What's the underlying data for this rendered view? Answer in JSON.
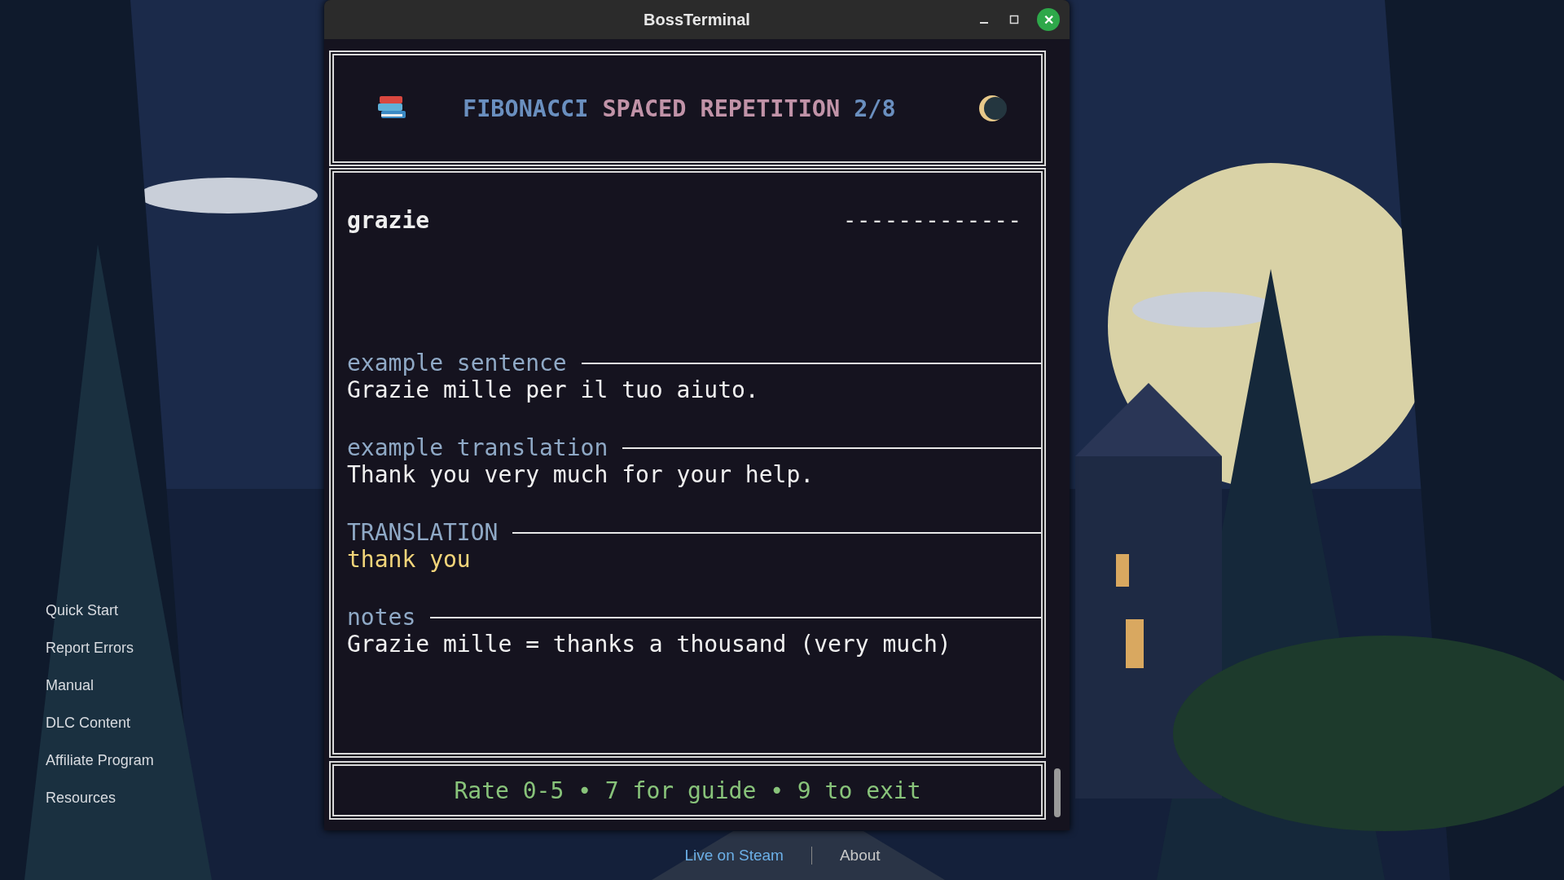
{
  "sidebar": {
    "items": [
      "Quick Start",
      "Report Errors",
      "Manual",
      "DLC Content",
      "Affiliate Program",
      "Resources"
    ]
  },
  "window": {
    "title": "BossTerminal",
    "close_icon": "✕"
  },
  "header": {
    "title_parts": [
      {
        "text": "FIBONACCI",
        "color": "#6a8fbf"
      },
      {
        "text": "SPACED REPETITION",
        "color": "#c193a8"
      },
      {
        "text": "2/8",
        "color": "#6a8fbf"
      }
    ]
  },
  "card": {
    "word": "grazie",
    "hidden_answer": "-------------",
    "sections": [
      {
        "label": "example sentence",
        "value": "Grazie mille per il tuo aiuto.",
        "kind": "plain"
      },
      {
        "label": "example translation",
        "value": "Thank you very much for your help.",
        "kind": "plain"
      },
      {
        "label": "TRANSLATION",
        "value": "thank you",
        "kind": "answer"
      },
      {
        "label": "notes",
        "value": "Grazie mille = thanks a thousand (very much)",
        "kind": "plain"
      }
    ]
  },
  "footer": {
    "hint": "Rate 0-5 • 7 for guide • 9 to exit"
  },
  "links": [
    {
      "label": "Live on Steam",
      "kind": "accent"
    },
    {
      "label": "About",
      "kind": "plain"
    }
  ]
}
